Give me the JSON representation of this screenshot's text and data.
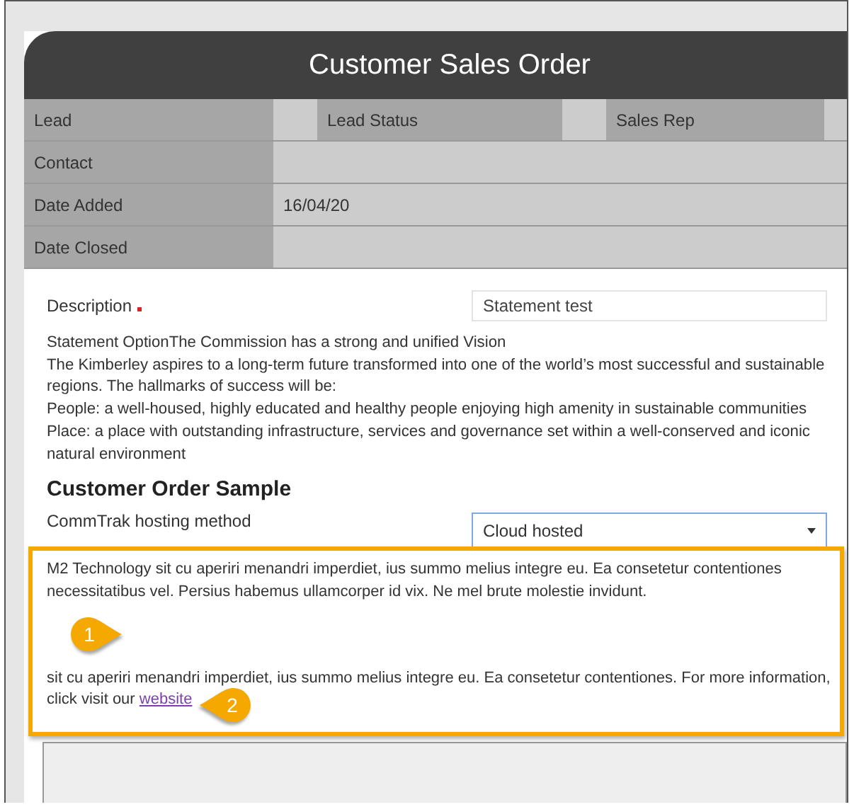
{
  "title": "Customer Sales Order",
  "rows": [
    {
      "label": "Lead",
      "extra_labels": [
        "Lead Status",
        "Sales Rep"
      ]
    },
    {
      "label": "Contact"
    },
    {
      "label": "Date Added",
      "value": "16/04/20"
    },
    {
      "label": "Date Closed"
    }
  ],
  "description": {
    "label": "Description",
    "required": true,
    "value": "Statement test"
  },
  "statement_lines": [
    "Statement OptionThe Commission has a strong and unified Vision",
    "The Kimberley aspires to a long-term future transformed into one of the world’s most successful and sustainable regions. The hallmarks of success will be:",
    "People: a well-housed, highly educated and healthy people enjoying high amenity in sustainable communities",
    "Place: a place with outstanding infrastructure, services and governance set within a well-conserved and iconic natural environment"
  ],
  "section_title": "Customer Order Sample",
  "hosting": {
    "label": "CommTrak hosting method",
    "value": "Cloud hosted"
  },
  "highlight_box": {
    "paragraphs": [
      {
        "text": "M2 Technology sit cu aperiri menandri imperdiet, ius summo melius integre eu. Ea consetetur contentiones necessitatibus vel. Persius habemus ullamcorper id vix. Ne mel brute molestie invidunt."
      },
      {
        "lines": [
          "sit cu aperiri menandri imperdiet, ius summo melius integre eu. Ea consetetur contentiones. For more information,",
          "click visit our "
        ],
        "link": "website"
      }
    ]
  },
  "callouts": [
    "1",
    "2"
  ]
}
